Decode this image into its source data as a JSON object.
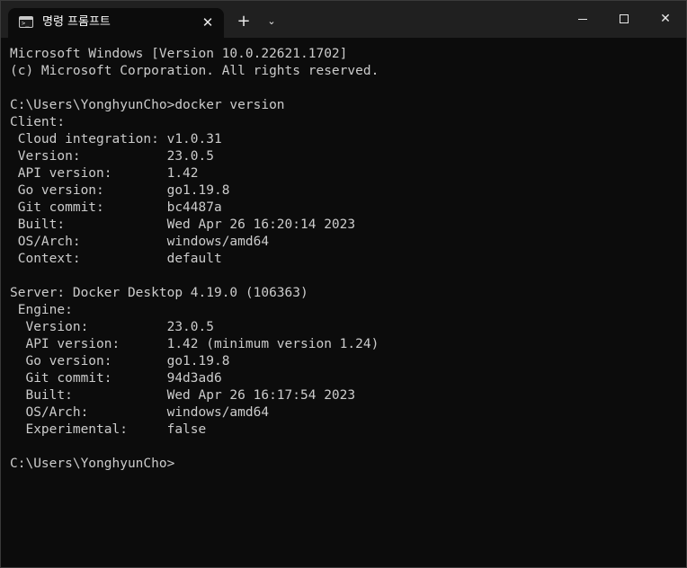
{
  "window": {
    "tab_title": "명령 프롬프트",
    "tab_icon_text": ">_",
    "close_tab_glyph": "✕",
    "new_tab_glyph": "+",
    "dropdown_glyph": "⌄",
    "close_glyph": "✕"
  },
  "terminal": {
    "lines": [
      "Microsoft Windows [Version 10.0.22621.1702]",
      "(c) Microsoft Corporation. All rights reserved.",
      "",
      "C:\\Users\\YonghyunCho>docker version",
      "Client:",
      " Cloud integration: v1.0.31",
      " Version:           23.0.5",
      " API version:       1.42",
      " Go version:        go1.19.8",
      " Git commit:        bc4487a",
      " Built:             Wed Apr 26 16:20:14 2023",
      " OS/Arch:           windows/amd64",
      " Context:           default",
      "",
      "Server: Docker Desktop 4.19.0 (106363)",
      " Engine:",
      "  Version:          23.0.5",
      "  API version:      1.42 (minimum version 1.24)",
      "  Go version:       go1.19.8",
      "  Git commit:       94d3ad6",
      "  Built:            Wed Apr 26 16:17:54 2023",
      "  OS/Arch:          windows/amd64",
      "  Experimental:     false",
      "",
      "C:\\Users\\YonghyunCho>"
    ]
  }
}
